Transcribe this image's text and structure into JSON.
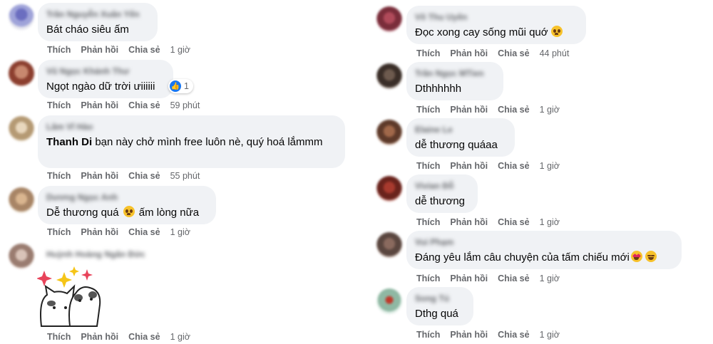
{
  "actions": {
    "like": "Thích",
    "reply": "Phản hồi",
    "share": "Chia sẻ"
  },
  "colors": {
    "bubble": "#f0f2f5",
    "meta": "#65676b",
    "text": "#050505",
    "like_blue": "#1877f2"
  },
  "left_comments": [
    {
      "author": "Trần Nguyễn Xuân Yến",
      "text": "Bát cháo siêu ấm",
      "time": "1 giờ"
    },
    {
      "author": "Vũ Ngọc Khánh Thư",
      "text": "Ngọt ngào dữ trời ưiiiiii",
      "time": "59 phút",
      "reactions": "1",
      "reaction_icon": "like-icon"
    },
    {
      "author": "Lâm Vĩ Hào",
      "mention": "Thanh Di",
      "text": " bạn này chở mình free luôn nè, quý hoá lắmmm",
      "time": "55 phút"
    },
    {
      "author": "Dương Ngọc Anh",
      "text": "Dễ thương quá",
      "text_after": " ấm lòng nữa",
      "time": "1 giờ",
      "emoji": "pleading-face-icon"
    },
    {
      "author": "Huỳnh Hoàng Ngân Đức",
      "time": "1 giờ",
      "sticker": "cat-and-panda-sticker"
    }
  ],
  "right_comments": [
    {
      "author": "Võ Thu Uyên",
      "text": "Đọc xong cay sống mũi quớ",
      "time": "44 phút",
      "emoji": "pleading-face-icon"
    },
    {
      "author": "Trần Ngọc MTien",
      "text": "Dthhhhhh",
      "time": "1 giờ"
    },
    {
      "author": "Elaine Le",
      "text": "dễ thương quáaa",
      "time": "1 giờ"
    },
    {
      "author": "Vivian Đỗ",
      "text": "dễ thương",
      "time": "1 giờ"
    },
    {
      "author": "Vui Phạm",
      "text": "Đáng yêu lắm câu chuyện của tấm chiếu mới",
      "time": "1 giờ",
      "emoji": "heart-eyes-icon",
      "emoji2": "smiling-face-icon"
    },
    {
      "author": "Song Tú",
      "text": "Dthg quá",
      "time": "1 giờ"
    }
  ]
}
